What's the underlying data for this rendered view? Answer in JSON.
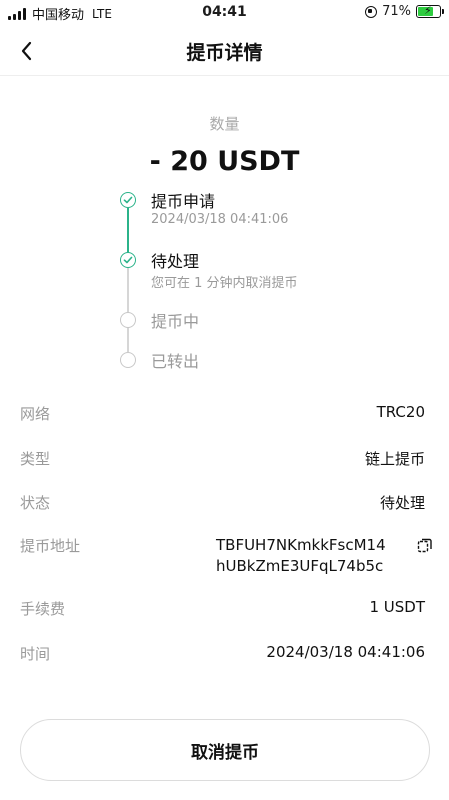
{
  "status_bar": {
    "carrier": "中国移动",
    "network": "LTE",
    "time": "04:41",
    "battery_percent": "71%",
    "battery_level": 0.71
  },
  "nav": {
    "title": "提币详情",
    "back_icon": "chevron-left-icon"
  },
  "amount": {
    "label": "数量",
    "value": "- 20 USDT"
  },
  "timeline": {
    "accent_color": "#2bb38a",
    "steps": [
      {
        "title": "提币申请",
        "subtitle": "2024/03/18 04:41:06",
        "done": true
      },
      {
        "title": "待处理",
        "subtitle": "您可在 1 分钟内取消提币",
        "done": true
      },
      {
        "title": "提币中",
        "subtitle": "",
        "done": false
      },
      {
        "title": "已转出",
        "subtitle": "",
        "done": false
      }
    ]
  },
  "details": {
    "network": {
      "label": "网络",
      "value": "TRC20"
    },
    "type": {
      "label": "类型",
      "value": "链上提币"
    },
    "status": {
      "label": "状态",
      "value": "待处理"
    },
    "address": {
      "label": "提币地址",
      "line1": "TBFUH7NKmkkFscM14",
      "line2": "hUBkZmE3UFqL74b5c",
      "icon": "copy-icon"
    },
    "fee": {
      "label": "手续费",
      "value": "1 USDT"
    },
    "time": {
      "label": "时间",
      "value": "2024/03/18 04:41:06"
    }
  },
  "actions": {
    "cancel_label": "取消提币"
  }
}
